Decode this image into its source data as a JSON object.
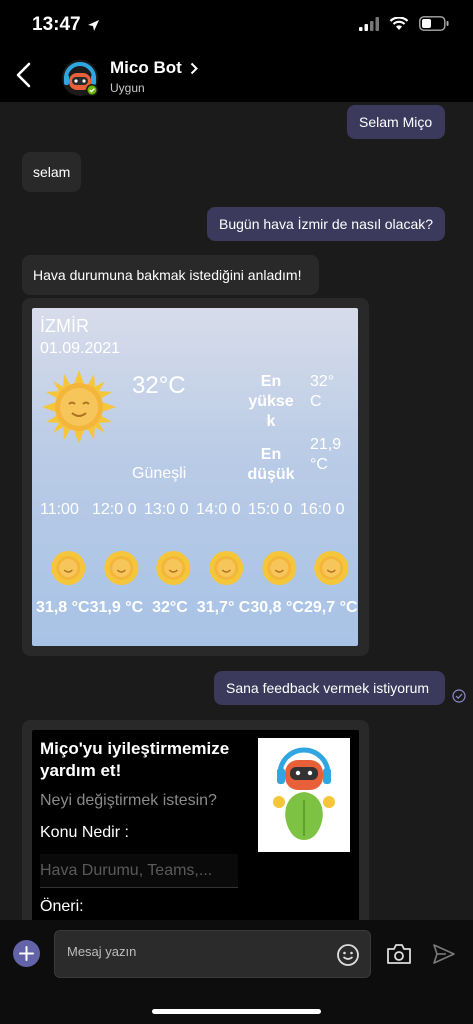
{
  "status_bar": {
    "time": "13:47"
  },
  "header": {
    "title": "Mico Bot",
    "subtitle": "Uygun"
  },
  "messages": {
    "m1": "Selam Miço",
    "m2": "selam",
    "m3": "Bugün hava İzmir de nasıl olacak?",
    "m4": "Hava durumuna bakmak istediğini anladım!",
    "m5": "Sana feedback vermek istiyorum"
  },
  "weather_card": {
    "city": "İZMİR",
    "date": "01.09.2021",
    "temperature": "32°C",
    "condition": "Güneşli",
    "high_label": "En yükse k",
    "high_value": "32° C",
    "low_label": "En düşük",
    "low_value": "21,9 °C",
    "forecast": [
      {
        "hour": "11:00",
        "temp": "31,8 °C"
      },
      {
        "hour": "12:0 0",
        "temp": "31,9 °C"
      },
      {
        "hour": "13:0 0",
        "temp": "32°C"
      },
      {
        "hour": "14:0 0",
        "temp": "31,7° C"
      },
      {
        "hour": "15:0 0",
        "temp": "30,8 °C"
      },
      {
        "hour": "16:0 0",
        "temp": "29,7 °C"
      }
    ]
  },
  "feedback_card": {
    "title": "Miço'yu iyileştirmemize yardım et!",
    "question": "Neyi değiştirmek istesin?",
    "topic_label": "Konu Nedir :",
    "topic_placeholder": "Hava Durumu, Teams,...",
    "suggestion_label": "Öneri:"
  },
  "composer": {
    "placeholder": "Mesaj yazın"
  },
  "colors": {
    "accent": "#6264a7",
    "bubble_out": "#3b3a5c",
    "bubble_in": "#292929"
  }
}
